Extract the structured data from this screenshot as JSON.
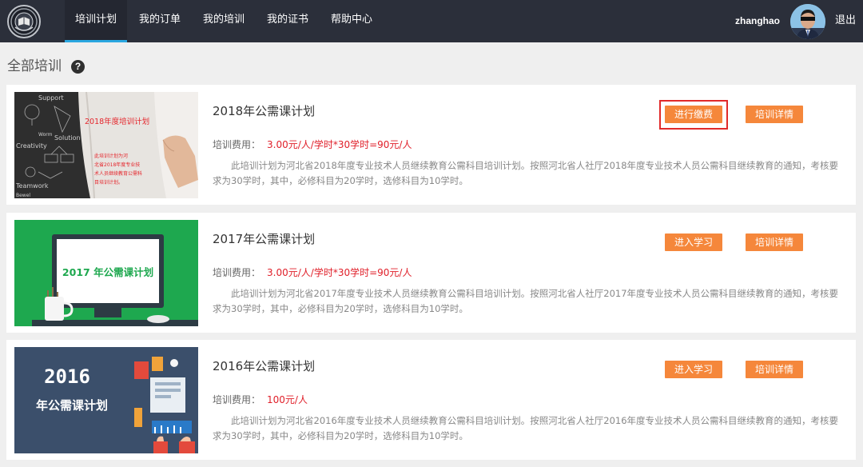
{
  "nav": {
    "items": [
      {
        "label": "培训计划",
        "active": true
      },
      {
        "label": "我的订单",
        "active": false
      },
      {
        "label": "我的培训",
        "active": false
      },
      {
        "label": "我的证书",
        "active": false
      },
      {
        "label": "帮助中心",
        "active": false
      }
    ],
    "username": "zhanghao",
    "logout": "退出"
  },
  "page": {
    "title": "全部培训",
    "help_icon": "question-circle-icon"
  },
  "fee_label": "培训费用：",
  "courses": [
    {
      "title": "2018年公需课计划",
      "fee": "3.00元/人/学时*30学时=90元/人",
      "description": "此培训计划为河北省2018年度专业技术人员继续教育公需科目培训计划。按照河北省人社厅2018年度专业技术人员公需科目继续教育的通知，考核要求为30学时，其中，必修科目为20学时，选修科目为10学时。",
      "primary_button": "进行缴费",
      "detail_button": "培训详情",
      "thumb_text": "2018年度培训计划",
      "thumb_note": [
        "此培训计划为河",
        "北省2018年度专业技",
        "术人员继续教育公需科",
        "目培训计划。"
      ],
      "thumb_words": [
        "Support",
        "Worm",
        "Solution",
        "Creativity",
        "Teamwork",
        "Bewel"
      ]
    },
    {
      "title": "2017年公需课计划",
      "fee": "3.00元/人/学时*30学时=90元/人",
      "description": "此培训计划为河北省2017年度专业技术人员继续教育公需科目培训计划。按照河北省人社厅2017年度专业技术人员公需科目继续教育的通知，考核要求为30学时，其中，必修科目为20学时，选修科目为10学时。",
      "primary_button": "进入学习",
      "detail_button": "培训详情",
      "thumb_text": "2017 年公需课计划"
    },
    {
      "title": "2016年公需课计划",
      "fee": "100元/人",
      "description": "此培训计划为河北省2016年度专业技术人员继续教育公需科目培训计划。按照河北省人社厅2016年度专业技术人员公需科目继续教育的通知，考核要求为30学时，其中，必修科目为20学时，选修科目为10学时。",
      "primary_button": "进入学习",
      "detail_button": "培训详情",
      "thumb_year": "2016",
      "thumb_text": "年公需课计划"
    }
  ],
  "colors": {
    "nav_bg": "#2b2f3a",
    "nav_active_underline": "#2aa7e0",
    "button": "#f5873b",
    "fee": "#e0202a",
    "highlight_box": "#e12a2a"
  }
}
